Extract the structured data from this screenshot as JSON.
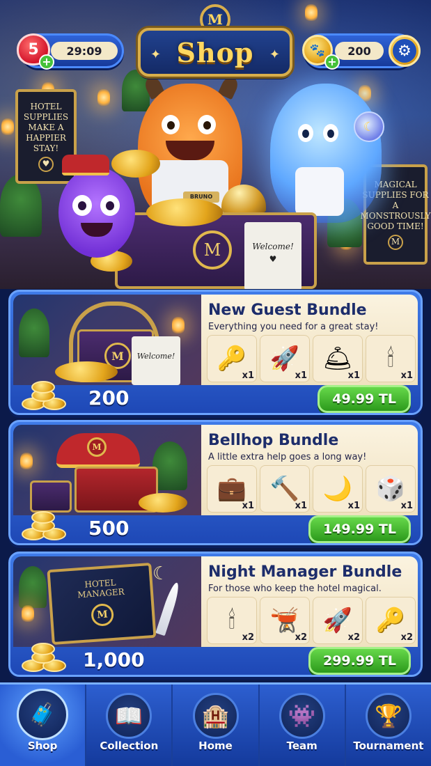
{
  "header": {
    "lives": "5",
    "timer": "29:09",
    "title": "Shop",
    "crest_letter": "M",
    "coins": "200"
  },
  "hero": {
    "left_sign": "HOTEL SUPPLIES MAKE A HAPPIER STAY!",
    "right_sign": "MAGICAL SUPPLIES FOR A MONSTROUSLY GOOD TIME!",
    "sign_monogram": "M",
    "name_tag": "BRUNO",
    "towel_text": "Welcome!",
    "chest_emblem": "M"
  },
  "bundles": [
    {
      "name": "New Guest Bundle",
      "description": "Everything you need for a great stay!",
      "coins": "200",
      "price": "49.99 TL",
      "art_label": "Welcome!",
      "art_emblem": "M",
      "items": [
        {
          "icon": "golden-key-icon",
          "glyph": "🔑",
          "qty": "x1"
        },
        {
          "icon": "ghost-rocket-icon",
          "glyph": "🚀",
          "qty": "x1"
        },
        {
          "icon": "service-bell-icon",
          "glyph": "🛎",
          "qty": "x1"
        },
        {
          "icon": "chandelier-icon",
          "glyph": "🕯",
          "qty": "x1"
        }
      ]
    },
    {
      "name": "Bellhop Bundle",
      "description": "A little extra help goes a long way!",
      "coins": "500",
      "price": "149.99 TL",
      "art_emblem": "M",
      "items": [
        {
          "icon": "suitcase-icon",
          "glyph": "💼",
          "qty": "x1"
        },
        {
          "icon": "hammer-icon",
          "glyph": "🔨",
          "qty": "x1"
        },
        {
          "icon": "moon-orb-icon",
          "glyph": "🌙",
          "qty": "x1"
        },
        {
          "icon": "dice-icon",
          "glyph": "🎲",
          "qty": "x1"
        }
      ]
    },
    {
      "name": "Night Manager Bundle",
      "description": "For those who keep the hotel magical.",
      "coins": "1,000",
      "price": "299.99 TL",
      "art_label": "HOTEL MANAGER",
      "art_emblem": "M",
      "items": [
        {
          "icon": "chandelier-icon",
          "glyph": "🕯",
          "qty": "x2"
        },
        {
          "icon": "cauldron-icon",
          "glyph": "🫕",
          "qty": "x2"
        },
        {
          "icon": "ghost-rocket-icon",
          "glyph": "🚀",
          "qty": "x2"
        },
        {
          "icon": "golden-key-icon",
          "glyph": "🔑",
          "qty": "x2"
        }
      ]
    }
  ],
  "nav": [
    {
      "label": "Shop",
      "icon": "shop-safe-icon",
      "glyph": "🧳",
      "active": true
    },
    {
      "label": "Collection",
      "icon": "collection-book-icon",
      "glyph": "📖",
      "active": false
    },
    {
      "label": "Home",
      "icon": "hotel-home-icon",
      "glyph": "🏨",
      "active": false
    },
    {
      "label": "Team",
      "icon": "team-monsters-icon",
      "glyph": "👾",
      "active": false
    },
    {
      "label": "Tournament",
      "icon": "trophy-icon",
      "glyph": "🏆",
      "active": false
    }
  ],
  "colors": {
    "primary_blue": "#2f63d8",
    "gold": "#d8ae4c",
    "price_green": "#3cb02a",
    "card_cream": "#f7ecd4"
  }
}
